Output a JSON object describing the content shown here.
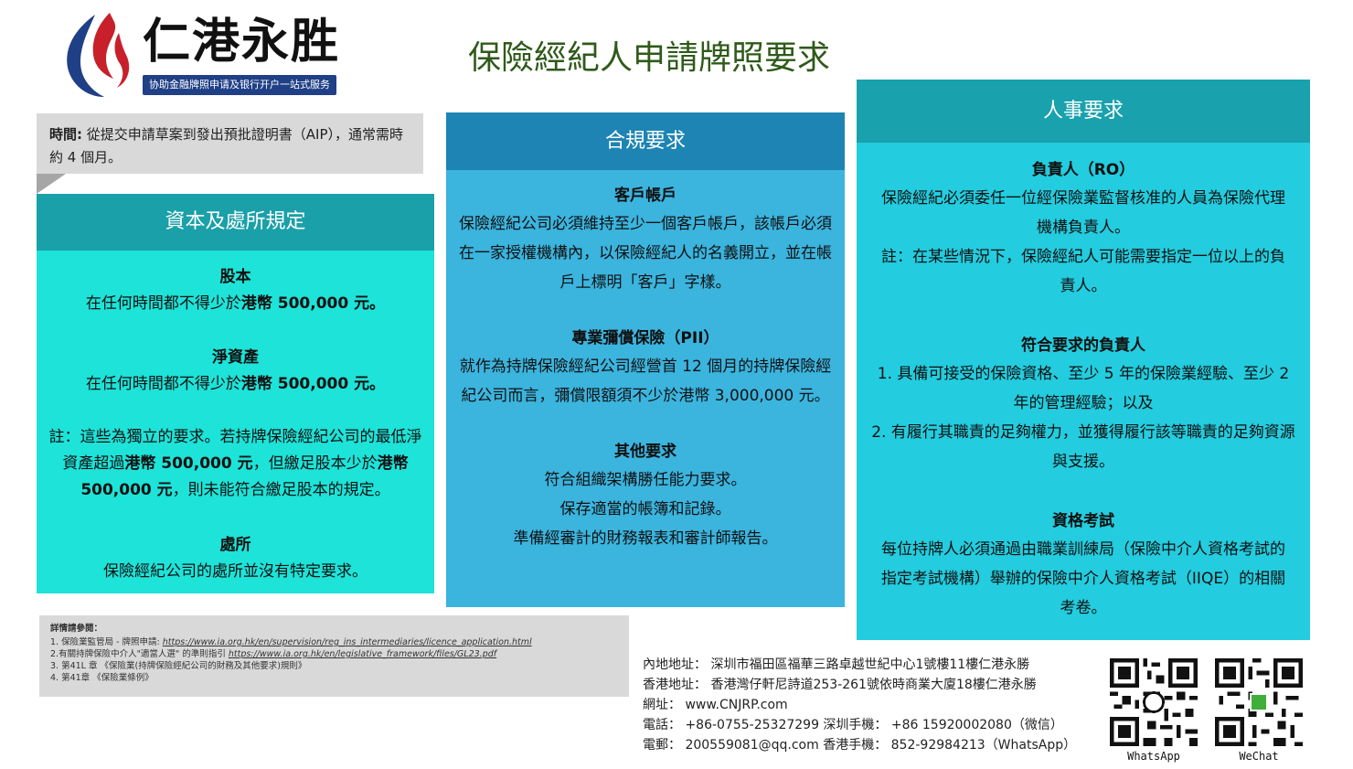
{
  "brand": {
    "name": "仁港永胜",
    "tagline": "协助金融牌照申请及银行开户一站式服务",
    "colors": {
      "red": "#c8202a",
      "navy": "#1f3f86"
    }
  },
  "page_title": "保險經紀人申請牌照要求",
  "timing": {
    "label": "時間:",
    "text": "從提交申請草案到發出預批證明書（AIP），通常需時約 4 個月。"
  },
  "capital": {
    "heading": "資本及處所規定",
    "share_capital": {
      "title": "股本",
      "pre": "在任何時間都不得少於",
      "amount": "港幣 500,000 元",
      "post": "。"
    },
    "net_assets": {
      "title": "淨資產",
      "pre": "在任何時間都不得少於",
      "amount": "港幣 500,000 元",
      "post": "。"
    },
    "note": {
      "p1": "註：這些為獨立的要求。若持牌保險經紀公司的最低淨資產超過",
      "a1": "港幣 500,000 元",
      "p2": "，但繳足股本少於",
      "a2": "港幣 500,000 元",
      "p3": "，則未能符合繳足股本的規定。"
    },
    "premises": {
      "title": "處所",
      "text": "保險經紀公司的處所並沒有特定要求。"
    }
  },
  "compliance": {
    "heading": "合規要求",
    "client_account": {
      "title": "客戶帳戶",
      "text": "保險經紀公司必須維持至少一個客戶帳戶，該帳戶必須在一家授權機構內，以保險經紀人的名義開立，並在帳戶上標明「客戶」字樣。"
    },
    "pii": {
      "title": "專業彌償保險（PII）",
      "text": "就作為持牌保險經紀公司經營首 12 個月的持牌保險經紀公司而言，彌償限額須不少於港幣 3,000,000 元。"
    },
    "other": {
      "title": "其他要求",
      "items": [
        "符合組織架構勝任能力要求。",
        "保存適當的帳簿和記錄。",
        "準備經審計的財務報表和審計師報告。"
      ]
    }
  },
  "personnel": {
    "heading": "人事要求",
    "ro": {
      "title": "負責人（RO）",
      "text": "保險經紀必須委任一位經保險業監督核准的人員為保險代理機構負責人。",
      "note": "註：在某些情況下，保險經紀人可能需要指定一位以上的負責人。"
    },
    "qualified_ro": {
      "title": "符合要求的負責人",
      "item1": "1. 具備可接受的保險資格、至少 5 年的保險業經驗、至少 2 年的管理經驗；以及",
      "item2": "2. 有履行其職責的足夠權力，並獲得履行該等職責的足夠資源與支援。"
    },
    "exam": {
      "title": "資格考試",
      "text": "每位持牌人必須通過由職業訓練局（保險中介人資格考試的指定考試機構）舉辦的保險中介人資格考試（IIQE）的相關考卷。"
    }
  },
  "references": {
    "title": "詳情請參閱：",
    "r1_prefix": "1. 保險業監管局 - 牌照申請: ",
    "r1_url": "https://www.ia.org.hk/en/supervision/reg_ins_intermediaries/licence_application.html",
    "r2_prefix": "2.有關持牌保險中介人\"適當人選\" 的準則指引  ",
    "r2_url": "https://www.ia.org.hk/en/legislative_framework/files/GL23.pdf",
    "r3": "3. 第41L 章 《保險業(持牌保險經紀公司的財務及其他要求)規則》",
    "r4": "4. 第41章 《保險業條例》"
  },
  "contact": {
    "line1": "內地地址：  深圳市福田區福華三路卓越世紀中心1號樓11樓仁港永勝",
    "line2": "香港地址：  香港灣仔軒尼詩道253-261號依時商業大廈18樓仁港永勝",
    "line3": "網址：  www.CNJRP.com",
    "line4": "電話：  +86-0755-25327299  深圳手機：  +86 15920002080（微信）",
    "line5": "電郵：  200559081@qq.com  香港手機：  852-92984213（WhatsApp）"
  },
  "qr": {
    "whatsapp_label": "WhatsApp",
    "wechat_label": "WeChat"
  }
}
